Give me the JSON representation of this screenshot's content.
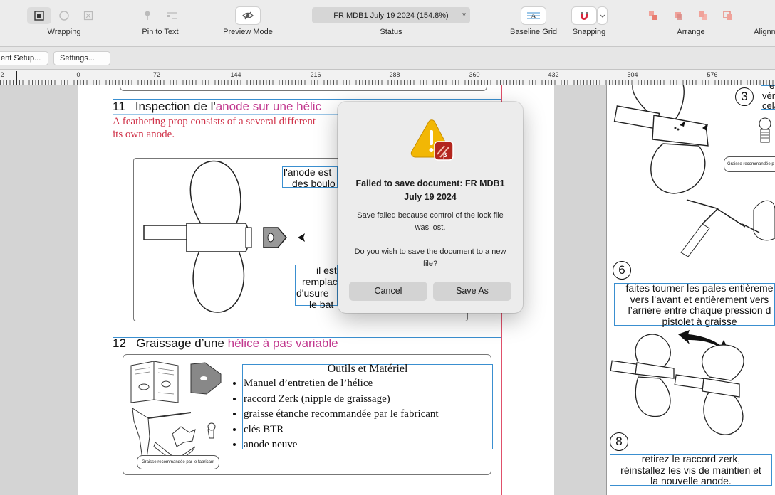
{
  "toolbar": {
    "wrapping_label": "Wrapping",
    "pin_label": "Pin to Text",
    "preview_label": "Preview Mode",
    "status_text": "FR MDB1  July 19 2024 (154.8%)",
    "status_marker": "*",
    "status_label": "Status",
    "baseline_label": "Baseline Grid",
    "snapping_label": "Snapping",
    "arrange_label": "Arrange",
    "align_label": "Alignm"
  },
  "subbar": {
    "doc_setup_label": "ent Setup...",
    "settings_label": "Settings..."
  },
  "ruler": {
    "labels": [
      "2",
      "0",
      "72",
      "144",
      "216",
      "288",
      "360",
      "432",
      "504",
      "576"
    ]
  },
  "document": {
    "section11": {
      "number": "11",
      "title_black": "Inspection de l'",
      "title_pink": "anode sur une hélic",
      "body": "A feathering prop consists of a several different",
      "body2": "its own anode.",
      "label_top_1": "l'anode est",
      "label_top_2": "des boulo",
      "label_mid_1": "il est",
      "label_mid_2": "remplac",
      "label_mid_3": "d'usure",
      "label_mid_4": "le bat"
    },
    "section12": {
      "number": "12",
      "title_black": "Graissage d’une ",
      "title_pink": "hélice à pas variable",
      "tools_title": "Outils et Matériel",
      "tools": [
        "Manuel d’entretien de l’hélice",
        "raccord Zerk (nipple de graissage)",
        "graisse étanche recommandée par le fabricant",
        "clés BTR",
        "anode neuve"
      ],
      "tube_label": "Graisse recommandée par le fabricant"
    },
    "right": {
      "step3": "3",
      "step3_text_1": "é",
      "step3_text_2": "véri",
      "step3_text_3": "cela",
      "tube_label": "Graisse recommandée p",
      "step6": "6",
      "step6_text": [
        "faites tourner les pales entièreme",
        "vers l’avant et entièrement vers",
        "l’arrière entre chaque pression d",
        "pistolet à graisse"
      ],
      "step8": "8",
      "step8_text": [
        "retirez le raccord zerk,",
        "réinstallez les vis de maintien et",
        "la nouvelle anode."
      ]
    }
  },
  "dialog": {
    "title": "Failed to save document: FR MDB1  July 19 2024",
    "message1": "Save failed because control of the lock file was lost.",
    "message2": "Do you wish to save the document to a new file?",
    "cancel_label": "Cancel",
    "save_as_label": "Save As",
    "badge_letter": "β"
  },
  "colors": {
    "pink": "#c2398f",
    "red_text": "#d0334a",
    "frame_blue": "#3a8fd0",
    "warning_yellow": "#f2b705"
  }
}
